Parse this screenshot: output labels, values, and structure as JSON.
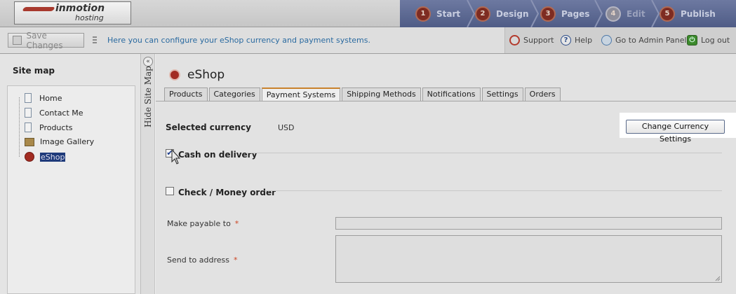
{
  "logo": {
    "line1": "inmotion",
    "line2": "hosting"
  },
  "steps": [
    {
      "num": "1",
      "label": "Start"
    },
    {
      "num": "2",
      "label": "Design"
    },
    {
      "num": "3",
      "label": "Pages"
    },
    {
      "num": "4",
      "label": "Edit"
    },
    {
      "num": "5",
      "label": "Publish"
    }
  ],
  "toolbar": {
    "save_label": "Save Changes",
    "hint": "Here you can configure your eShop currency and payment systems.",
    "support": "Support",
    "help": "Help",
    "admin": "Go to Admin Panel",
    "logout": "Log out"
  },
  "sidebar": {
    "title": "Site map",
    "items": [
      {
        "label": "Home",
        "icon": "page-icon"
      },
      {
        "label": "Contact Me",
        "icon": "page-icon"
      },
      {
        "label": "Products",
        "icon": "page-icon"
      },
      {
        "label": "Image Gallery",
        "icon": "gallery-icon"
      },
      {
        "label": "eShop",
        "icon": "eshop-icon"
      }
    ],
    "hide_label": "Hide Site Map"
  },
  "main": {
    "title": "eShop",
    "tabs": [
      "Products",
      "Categories",
      "Payment Systems",
      "Shipping Methods",
      "Notifications",
      "Settings",
      "Orders"
    ],
    "active_tab": "Payment Systems",
    "selected_currency_label": "Selected currency",
    "currency": "USD",
    "change_currency_label": "Change Currency Settings",
    "cash_on_delivery": "Cash on delivery",
    "cash_checked": true,
    "check_money_order": "Check / Money order",
    "check_checked": false,
    "make_payable_label": "Make payable to",
    "send_address_label": "Send to address",
    "required_mark": "*"
  },
  "colors": {
    "steps_bar": "#4f5c86",
    "hint_link": "#2a6aa0",
    "active_tab_accent": "#c9822c",
    "required": "#cc4422"
  }
}
